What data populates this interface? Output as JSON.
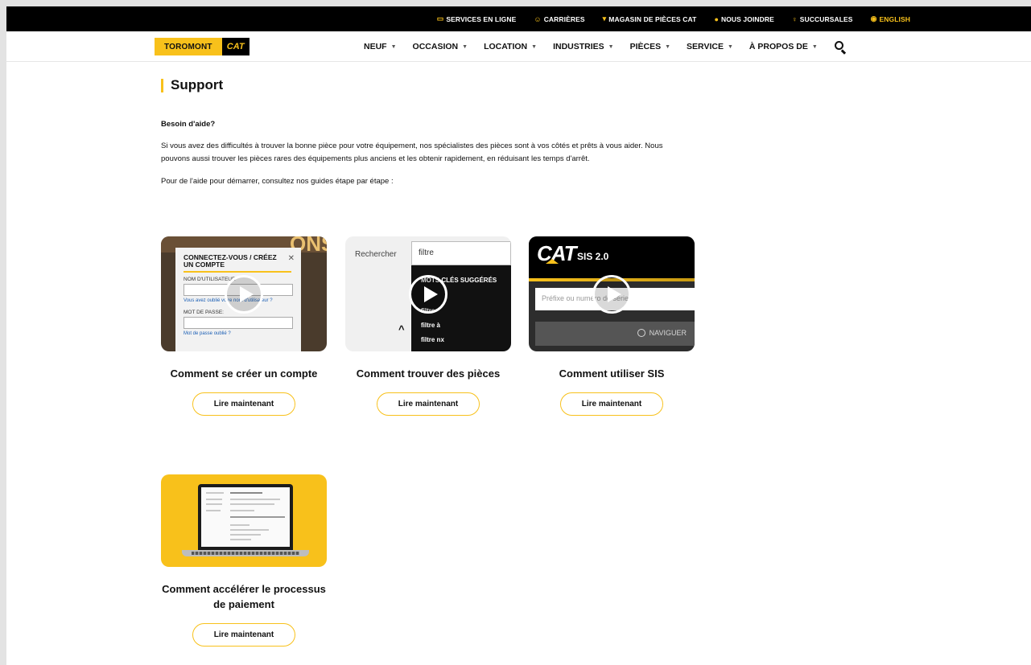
{
  "topbar": {
    "links": [
      {
        "icon": "laptop-icon",
        "glyph": "▭",
        "label": "SERVICES EN LIGNE"
      },
      {
        "icon": "people-icon",
        "glyph": "☺",
        "label": "CARRIÈRES"
      },
      {
        "icon": "cart-icon",
        "glyph": "▾",
        "label": "MAGASIN DE PIÈCES CAT"
      },
      {
        "icon": "chat-icon",
        "glyph": "●",
        "label": "NOUS JOINDRE"
      },
      {
        "icon": "location-pin-icon",
        "glyph": "♀",
        "label": "SUCCURSALES"
      },
      {
        "icon": "globe-icon",
        "glyph": "◉",
        "label": "ENGLISH"
      }
    ]
  },
  "logo": {
    "toromont": "TOROMONT",
    "cat": "CAT"
  },
  "nav": {
    "items": [
      "NEUF",
      "OCCASION",
      "LOCATION",
      "INDUSTRIES",
      "PIÈCES",
      "SERVICE",
      "À PROPOS DE"
    ],
    "chevron": "▼"
  },
  "page": {
    "title": "Support",
    "subhead": "Besoin d'aide?",
    "paragraph": "Si vous avez des difficultés à trouver la bonne pièce pour votre équipement, nos spécialistes des pièces sont à vos côtés et prêts à vous aider. Nous pouvons aussi trouver les pièces rares des équipements plus anciens et les obtenir rapidement, en réduisant les temps d'arrêt.",
    "paragraph2": "Pour de l'aide pour démarrer, consultez nos guides étape par étape :"
  },
  "cards": [
    {
      "title": "Comment se créer un compte",
      "button": "Lire maintenant",
      "thumb": {
        "bg_text": "ONS",
        "modal_title": "CONNECTEZ-VOUS / CRÉEZ UN COMPTE",
        "close": "✕",
        "user_label": "NOM D'UTILISATEUR",
        "forgot_user": "Vous avez oublié votre nom d'utilisateur ?",
        "pass_label": "MOT DE PASSE:",
        "forgot_pass": "Mot de passe oublié ?"
      }
    },
    {
      "title": "Comment trouver des pièces",
      "button": "Lire maintenant",
      "thumb": {
        "search_label": "Rechercher",
        "search_value": "filtre",
        "suggest_header": "MOTS CLÉS SUGGÉRÉS",
        "suggestions": [
          "filtre",
          "filtre à",
          "filtre nx"
        ],
        "caret": "^"
      }
    },
    {
      "title": "Comment utiliser SIS",
      "button": "Lire maintenant",
      "thumb": {
        "brand": "CAT",
        "product": "SIS 2.0",
        "placeholder": "Préfixe ou numéro de série",
        "navigate": "NAVIGUER"
      }
    },
    {
      "title": "Comment accélérer le processus de paiement",
      "button": "Lire maintenant",
      "thumb": {}
    }
  ]
}
